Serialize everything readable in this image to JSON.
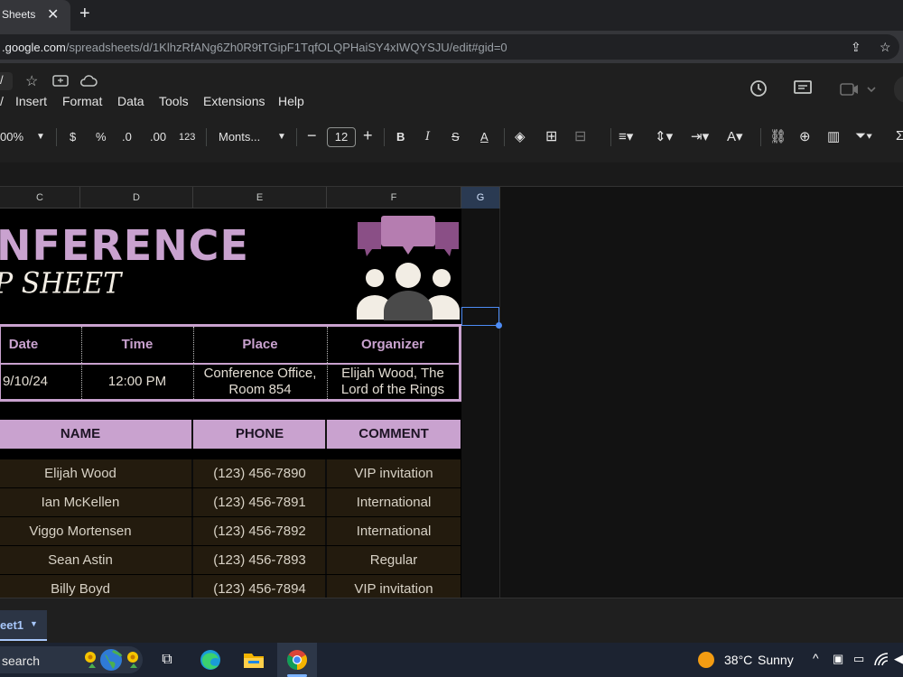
{
  "browser": {
    "tab_title": "Sheets",
    "url_host": ".google.com",
    "url_path": "/spreadsheets/d/1KlhzRfANg6Zh0R9tTGipF1TqfOLQPHaiSY4xIWQYSJU/edit#gid=0"
  },
  "menu": {
    "items": [
      "Insert",
      "Format",
      "Data",
      "Tools",
      "Extensions",
      "Help"
    ]
  },
  "format_toolbar": {
    "zoom": "00%",
    "currency": "$",
    "percent": "%",
    "dec_decrease": ".0",
    "dec_increase": ".00",
    "number_format": "123",
    "font": "Monts...",
    "font_size": "12"
  },
  "columns": [
    "C",
    "D",
    "E",
    "F",
    "G"
  ],
  "banner": {
    "title": "NFERENCE",
    "subtitle": "P SHEET"
  },
  "info": {
    "headers": [
      "Date",
      "Time",
      "Place",
      "Organizer"
    ],
    "values": [
      "9/10/24",
      "12:00 PM",
      "Conference Office, Room 854",
      "Elijah Wood, The Lord of the Rings"
    ]
  },
  "guests": {
    "headers": [
      "NAME",
      "PHONE",
      "COMMENT"
    ],
    "rows": [
      [
        "Elijah Wood",
        "(123) 456-7890",
        "VIP invitation"
      ],
      [
        "Ian McKellen",
        "(123) 456-7891",
        "International"
      ],
      [
        "Viggo Mortensen",
        "(123) 456-7892",
        "International"
      ],
      [
        "Sean Astin",
        "(123) 456-7893",
        "Regular"
      ],
      [
        "Billy Boyd",
        "(123) 456-7894",
        "VIP invitation"
      ]
    ]
  },
  "sheet_tab": "eet1",
  "taskbar": {
    "search_label": "search",
    "weather_temp": "38°C",
    "weather_desc": "Sunny"
  },
  "colors": {
    "accent": "#c9a2cf",
    "row_bg": "#231b0e",
    "selection": "#4d8cf5"
  }
}
